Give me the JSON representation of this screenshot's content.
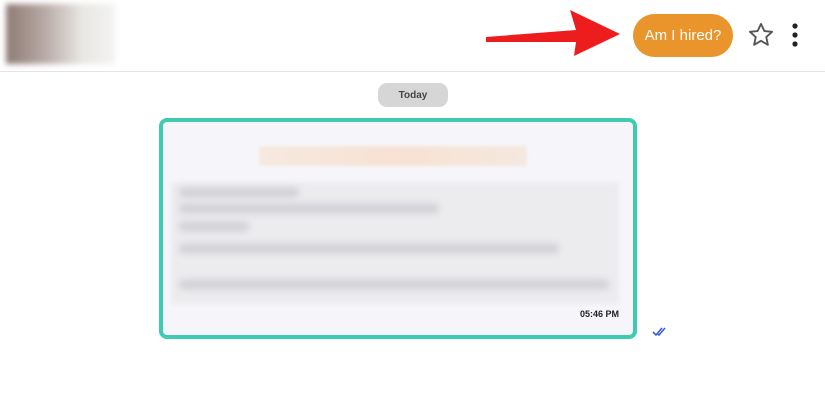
{
  "header": {
    "hired_button_label": "Am I hired?"
  },
  "chat": {
    "date_separator": "Today",
    "messages": [
      {
        "time": "05:46 PM",
        "status": "read"
      }
    ]
  },
  "icons": {
    "arrow": "arrow-right-icon",
    "star": "star-outline-icon",
    "menu": "more-vertical-icon",
    "read_receipt": "double-check-icon"
  },
  "colors": {
    "hired_button": "#e9952b",
    "bubble_border": "#3ecbb2",
    "arrow": "#ee1d1d",
    "read_ticks": "#3b5bdb"
  }
}
